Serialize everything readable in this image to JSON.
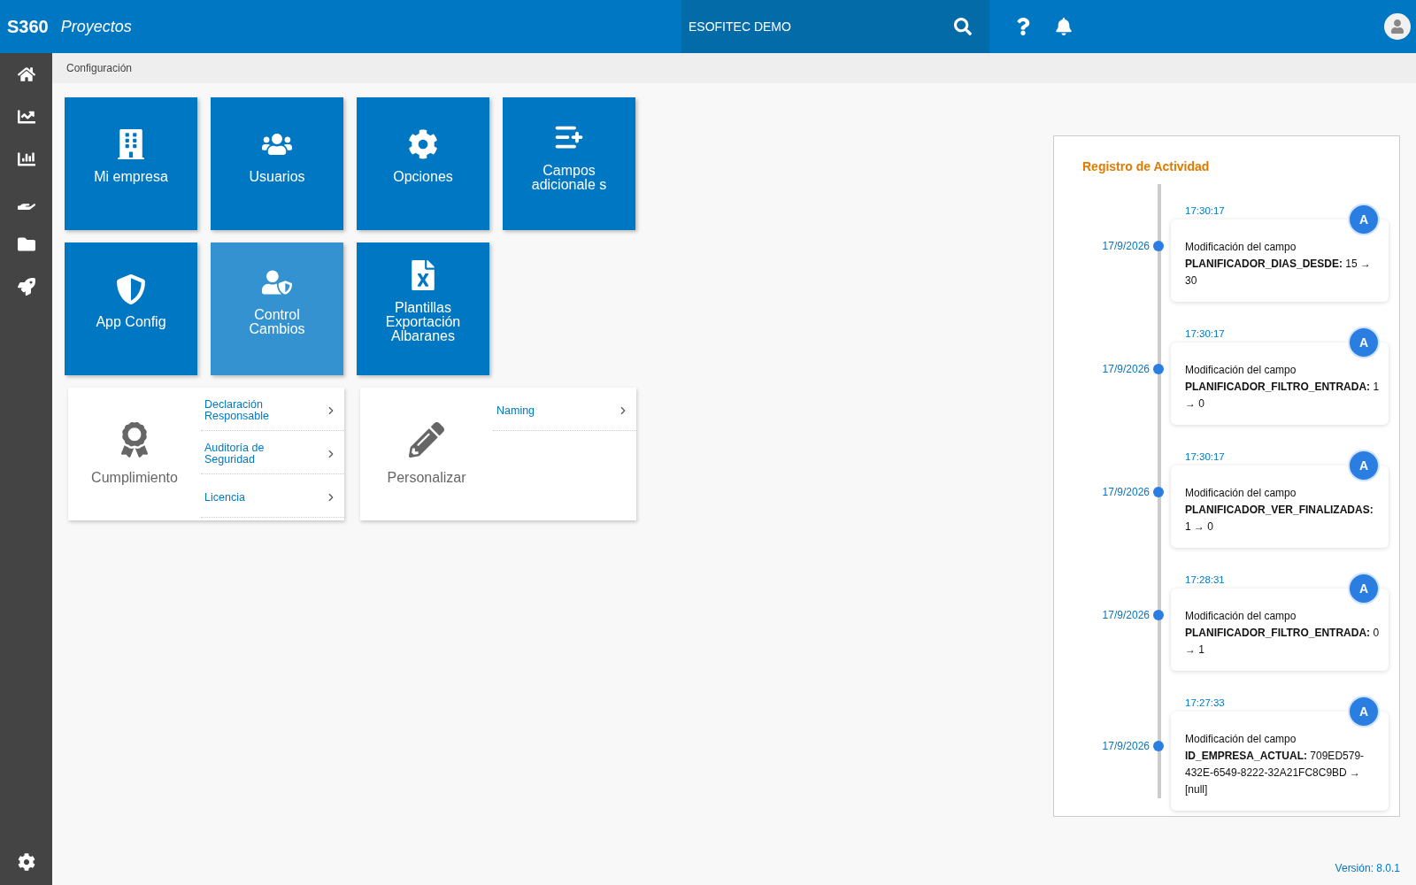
{
  "header": {
    "brand": "S360",
    "app": "Proyectos",
    "company": "ESOFITEC DEMO"
  },
  "breadcrumb": "Configuración",
  "tiles": [
    {
      "label": "Mi empresa",
      "selected": false
    },
    {
      "label": "Usuarios",
      "selected": false
    },
    {
      "label": "Opciones",
      "selected": false
    },
    {
      "label": "Campos adicionale s",
      "selected": false
    },
    {
      "label": "App Config",
      "selected": false
    },
    {
      "label": "Control Cambios",
      "selected": true
    },
    {
      "label": "Plantillas Exportación Albaranes",
      "selected": false
    }
  ],
  "cards": [
    {
      "title": "Cumplimiento",
      "links": [
        "Declaración Responsable",
        "Auditoría de Seguridad",
        "Licencia"
      ]
    },
    {
      "title": "Personalizar",
      "links": [
        "Naming"
      ]
    }
  ],
  "activity": {
    "title": "Registro de Actividad",
    "entries": [
      {
        "time": "17:30:17",
        "date": "17/9/2026",
        "avatar": "A",
        "text": "Modificación del campo **PLANIFICADOR_DIAS_DESDE:** 15 → 30"
      },
      {
        "time": "17:30:17",
        "date": "17/9/2026",
        "avatar": "A",
        "text": "Modificación del campo **PLANIFICADOR_FILTRO_ENTRADA:** 1 → 0"
      },
      {
        "time": "17:30:17",
        "date": "17/9/2026",
        "avatar": "A",
        "text": "Modificación del campo **PLANIFICADOR_VER_FINALIZADAS:** 1 → 0"
      },
      {
        "time": "17:28:31",
        "date": "17/9/2026",
        "avatar": "A",
        "text": "Modificación del campo **PLANIFICADOR_FILTRO_ENTRADA:** 0 → 1"
      },
      {
        "time": "17:27:33",
        "date": "17/9/2026",
        "avatar": "A",
        "text": "Modificación del campo **ID_EMPRESA_ACTUAL:** 709ED579-432E-6549-8222-32A21FC8C9BD → [null]"
      }
    ]
  },
  "version": "Versión: 8.0.1"
}
